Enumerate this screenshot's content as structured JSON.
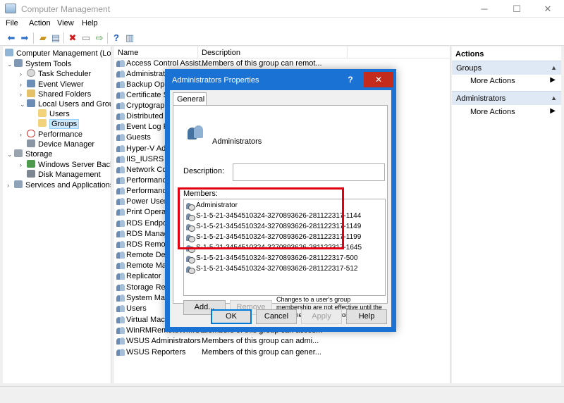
{
  "window": {
    "title": "Computer Management",
    "min_glyph": "─",
    "max_glyph": "☐",
    "close_glyph": "✕"
  },
  "menu": [
    "File",
    "Action",
    "View",
    "Help"
  ],
  "tree": [
    {
      "label": "Computer Management (Local",
      "indent": 0
    },
    {
      "label": "System Tools",
      "indent": 1
    },
    {
      "label": "Task Scheduler",
      "indent": 2
    },
    {
      "label": "Event Viewer",
      "indent": 2
    },
    {
      "label": "Shared Folders",
      "indent": 2
    },
    {
      "label": "Local Users and Groups",
      "indent": 2
    },
    {
      "label": "Users",
      "indent": 3
    },
    {
      "label": "Groups",
      "indent": 3
    },
    {
      "label": "Performance",
      "indent": 2
    },
    {
      "label": "Device Manager",
      "indent": 2
    },
    {
      "label": "Storage",
      "indent": 1
    },
    {
      "label": "Windows Server Backup",
      "indent": 2
    },
    {
      "label": "Disk Management",
      "indent": 2
    },
    {
      "label": "Services and Applications",
      "indent": 1
    }
  ],
  "list": {
    "col_name": "Name",
    "col_desc": "Description",
    "rows": [
      {
        "name": "Access Control Assist...",
        "desc": "Members of this group can remot..."
      },
      {
        "name": "Administrators",
        "desc": ""
      },
      {
        "name": "Backup Operators",
        "desc": ""
      },
      {
        "name": "Certificate Se",
        "desc": ""
      },
      {
        "name": "Cryptograph",
        "desc": ""
      },
      {
        "name": "Distributed C",
        "desc": ""
      },
      {
        "name": "Event Log Re",
        "desc": ""
      },
      {
        "name": "Guests",
        "desc": ""
      },
      {
        "name": "Hyper-V Adm",
        "desc": ""
      },
      {
        "name": "IIS_IUSRS",
        "desc": ""
      },
      {
        "name": "Network Con",
        "desc": ""
      },
      {
        "name": "Performance",
        "desc": ""
      },
      {
        "name": "Performance",
        "desc": ""
      },
      {
        "name": "Power Users",
        "desc": ""
      },
      {
        "name": "Print Operato",
        "desc": ""
      },
      {
        "name": "RDS Endpoin",
        "desc": ""
      },
      {
        "name": "RDS Manage",
        "desc": ""
      },
      {
        "name": "RDS Remote",
        "desc": ""
      },
      {
        "name": "Remote Desk",
        "desc": ""
      },
      {
        "name": "Remote Man",
        "desc": ""
      },
      {
        "name": "Replicator",
        "desc": ""
      },
      {
        "name": "Storage Repli",
        "desc": ""
      },
      {
        "name": "System Mana",
        "desc": ""
      },
      {
        "name": "Users",
        "desc": ""
      },
      {
        "name": "Virtual Mach",
        "desc": ""
      },
      {
        "name": "WinRMRemoteWMIU...",
        "desc": "Members of this group can acces..."
      },
      {
        "name": "WSUS Administrators",
        "desc": "Members of this group can admi..."
      },
      {
        "name": "WSUS Reporters",
        "desc": "Members of this group can gener..."
      }
    ]
  },
  "actions": {
    "header": "Actions",
    "sections": [
      {
        "title": "Groups",
        "item": "More Actions"
      },
      {
        "title": "Administrators",
        "item": "More Actions"
      }
    ]
  },
  "dialog": {
    "title": "Administrators Properties",
    "help_glyph": "?",
    "close_glyph": "✕",
    "tab": "General",
    "group_name": "Administrators",
    "description_label": "Description:",
    "description_value": "",
    "members_label": "Members:",
    "members": [
      "Administrator",
      "S-1-5-21-3454510324-3270893626-281122317-1144",
      "S-1-5-21-3454510324-3270893626-281122317-1149",
      "S-1-5-21-3454510324-3270893626-281122317-1199",
      "S-1-5-21-3454510324-3270893626-281122317-1645",
      "S-1-5-21-3454510324-3270893626-281122317-500",
      "S-1-5-21-3454510324-3270893626-281122317-512"
    ],
    "add_label": "Add...",
    "remove_label": "Remove",
    "note": "Changes to a user's group membership are not effective until the next time the user logs on.",
    "ok_label": "OK",
    "cancel_label": "Cancel",
    "apply_label": "Apply",
    "help_label": "Help",
    "accent_color": "#1a73d4",
    "highlight_color": "#e00012",
    "close_color": "#c42b1c"
  }
}
